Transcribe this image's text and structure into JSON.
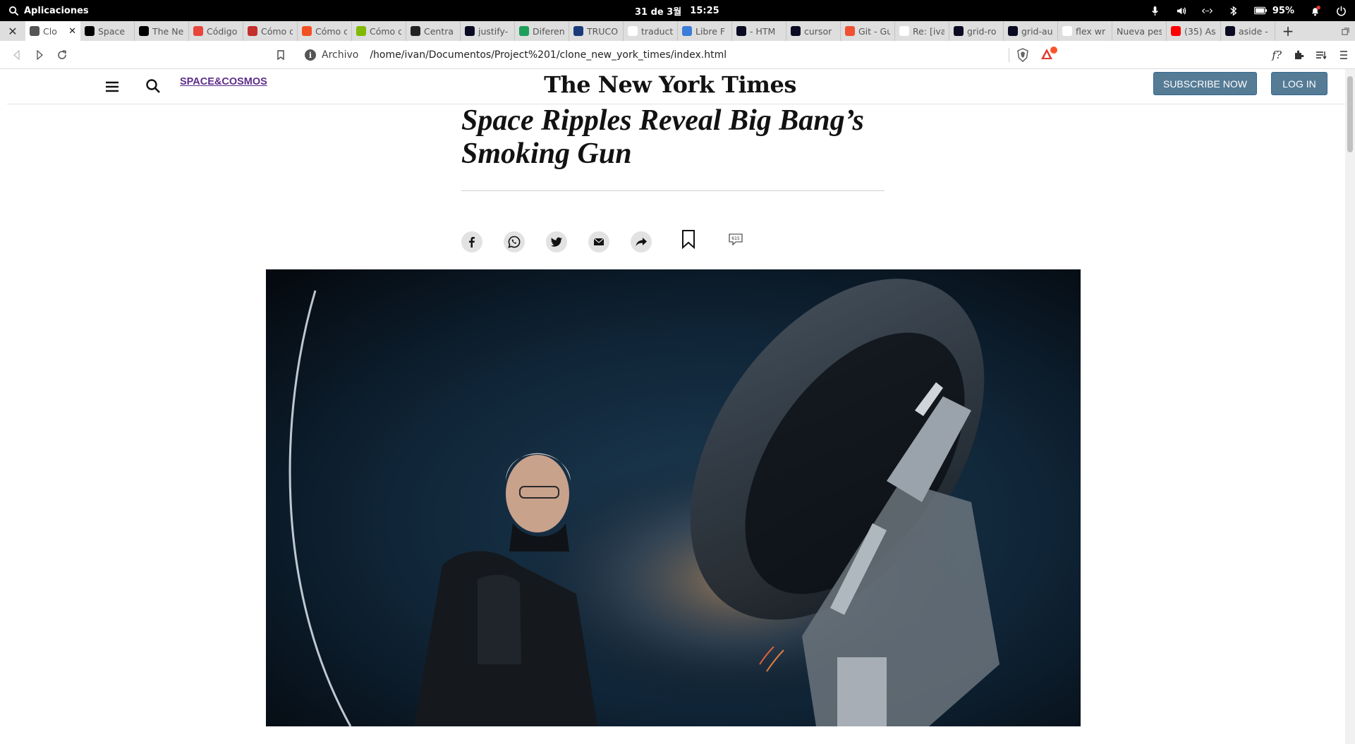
{
  "os_bar": {
    "apps_label": "Aplicaciones",
    "date": "31 de 3월",
    "time": "15:25",
    "battery": "95%"
  },
  "tabs": [
    {
      "label": "Clo",
      "icon": "globe-icon",
      "color": "#555555",
      "active": true
    },
    {
      "label": "Space",
      "icon": "nyt-icon",
      "color": "#000000"
    },
    {
      "label": "The Ne",
      "icon": "nyt-icon",
      "color": "#000000"
    },
    {
      "label": "Código",
      "icon": "record-icon",
      "color": "#e8453c"
    },
    {
      "label": "Cómo c",
      "icon": "quora-icon",
      "color": "#c4302b"
    },
    {
      "label": "Cómo c",
      "icon": "microsoft-icon",
      "color": "#f25022"
    },
    {
      "label": "Cómo c",
      "icon": "microsoft-icon",
      "color": "#7fba00"
    },
    {
      "label": "Centra",
      "icon": "glasses-icon",
      "color": "#222222"
    },
    {
      "label": "justify-",
      "icon": "fcc-icon",
      "color": "#0a0a23"
    },
    {
      "label": "Diferen",
      "icon": "play-icon",
      "color": "#1e9e5a"
    },
    {
      "label": "TRUCO",
      "icon": "site-icon",
      "color": "#1a3a7a"
    },
    {
      "label": "traduct",
      "icon": "google-icon",
      "color": "#ffffff"
    },
    {
      "label": "Libre F",
      "icon": "puzzle-icon",
      "color": "#3b7dd8"
    },
    {
      "label": "- HTM",
      "icon": "fcc-icon",
      "color": "#0a0a23"
    },
    {
      "label": "cursor",
      "icon": "fcc-icon",
      "color": "#0a0a23"
    },
    {
      "label": "Git - Gu",
      "icon": "git-icon",
      "color": "#f05133"
    },
    {
      "label": "Re: [iva",
      "icon": "gmail-icon",
      "color": "#ffffff"
    },
    {
      "label": "grid-ro",
      "icon": "fcc-icon",
      "color": "#0a0a23"
    },
    {
      "label": "grid-au",
      "icon": "fcc-icon",
      "color": "#0a0a23"
    },
    {
      "label": "flex wr",
      "icon": "google-icon",
      "color": "#ffffff"
    },
    {
      "label": "Nueva pest",
      "icon": "none",
      "color": "#dedede"
    },
    {
      "label": "(35) As",
      "icon": "youtube-icon",
      "color": "#ff0000"
    },
    {
      "label": "aside -",
      "icon": "fcc-icon",
      "color": "#0a0a23"
    }
  ],
  "address_bar": {
    "scheme_label": "Archivo",
    "url": "/home/ivan/Documentos/Project%201/clone_new_york_times/index.html",
    "font_button": "f?"
  },
  "site": {
    "section": "SPACE&COSMOS",
    "masthead": "The New York Times",
    "subscribe": "SUBSCRIBE NOW",
    "login": "LOG IN"
  },
  "article": {
    "headline": "Space Ripples Reveal Big Bang’s Smoking Gun",
    "comments_count": "615",
    "share_buttons": [
      "facebook-icon",
      "whatsapp-icon",
      "twitter-icon",
      "email-icon",
      "share-arrow-icon"
    ]
  },
  "colors": {
    "accent_button": "#567b95",
    "section_link": "#5d2d8a",
    "os_bar": "#000000"
  }
}
